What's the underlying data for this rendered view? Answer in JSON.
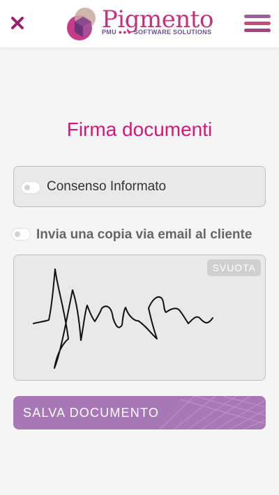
{
  "header": {
    "close_icon": "close-icon",
    "menu_icon": "hamburger-menu-icon",
    "logo": {
      "name": "Pigmento",
      "tagline_prefix": "PMU",
      "tagline_dots": "●●●",
      "tagline_suffix": "SOFTWARE SOLUTIONS"
    }
  },
  "page": {
    "title": "Firma documenti"
  },
  "consent": {
    "label": "Consenso Informato",
    "checked": false
  },
  "email_copy": {
    "label": "Invia una copia via email al cliente",
    "checked": false
  },
  "signature": {
    "clear_label": "SVUOTA"
  },
  "actions": {
    "save_label": "SALVA DOCUMENTO"
  },
  "colors": {
    "accent": "#d6177a",
    "brand_purple": "#a877b6",
    "close": "#9c1e6e",
    "menu_top": "#a0609a",
    "menu_middle": "#c94b77",
    "menu_bottom": "#b23e81"
  }
}
